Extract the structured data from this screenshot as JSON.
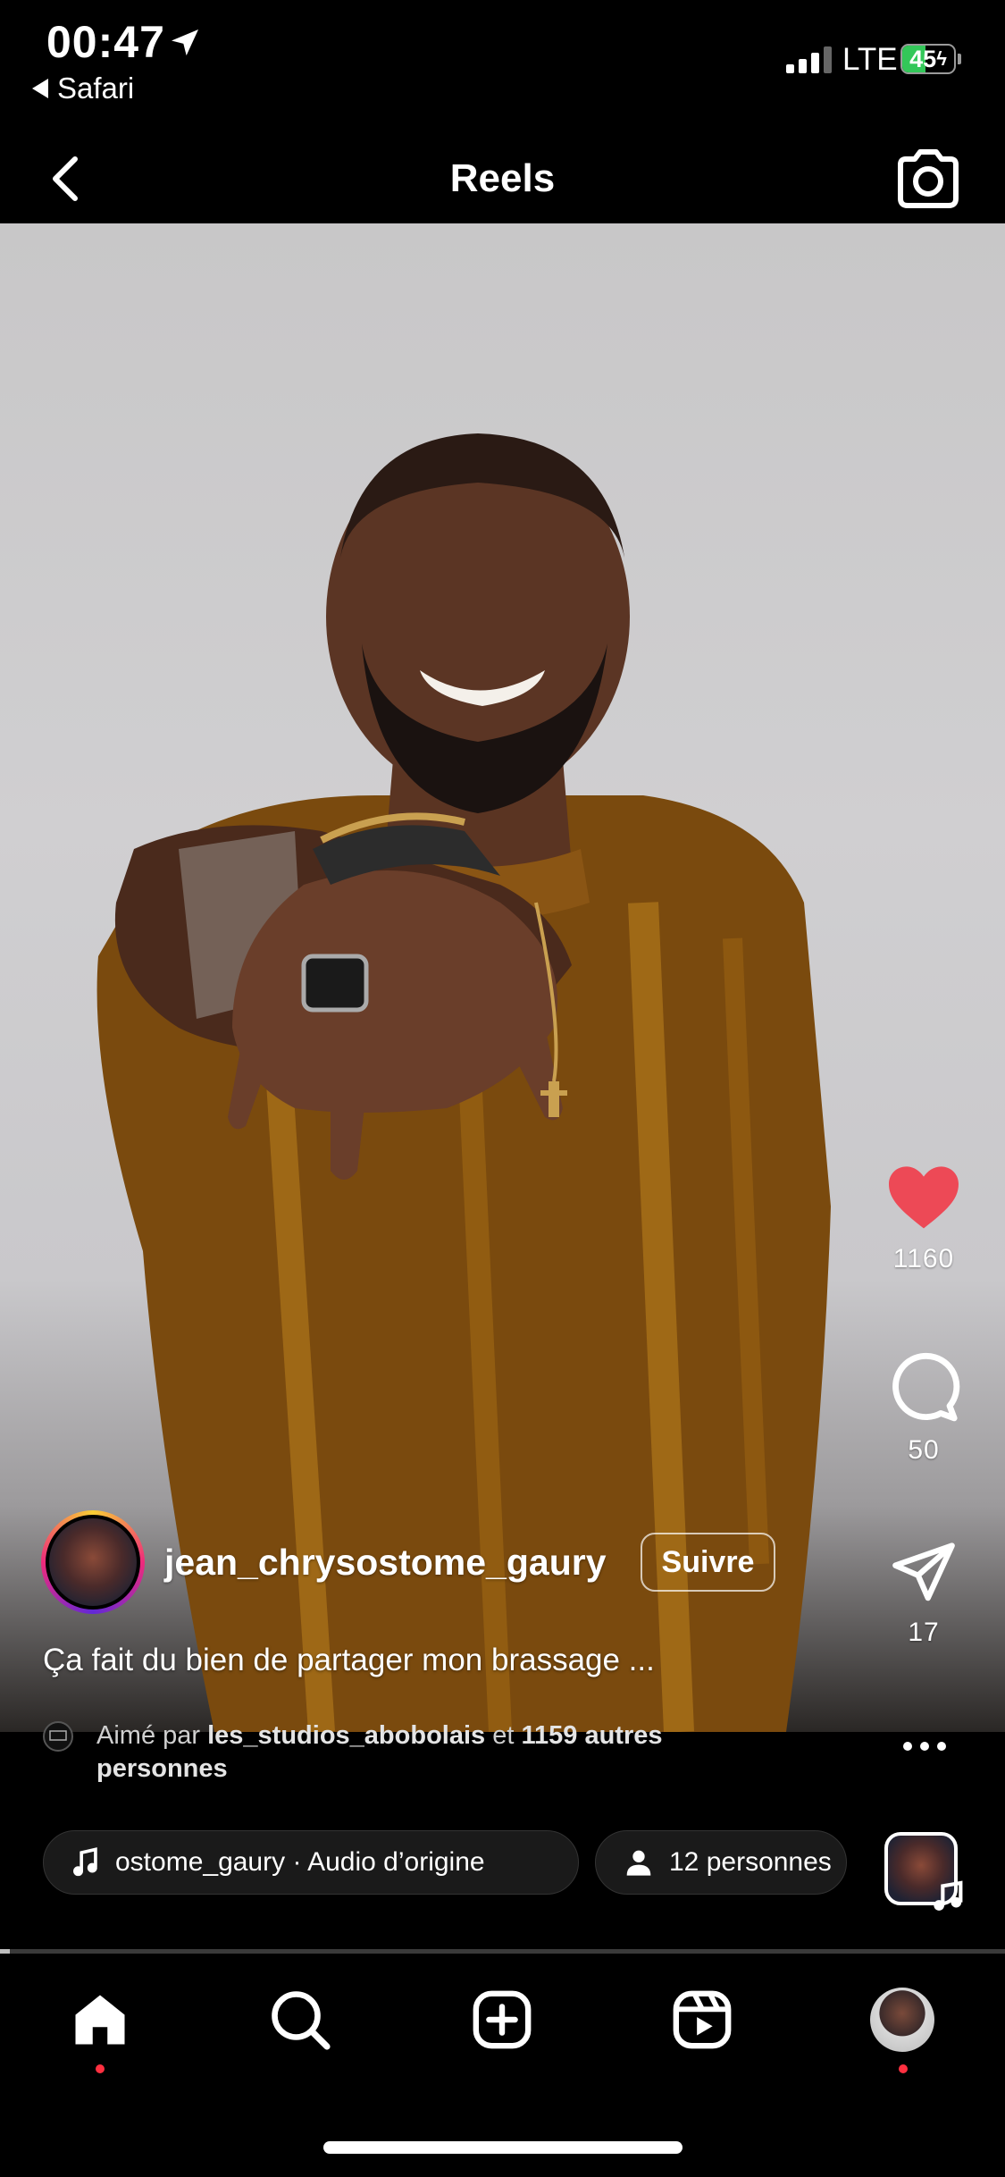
{
  "status_bar": {
    "time": "00:47",
    "back_app": "Safari",
    "network": "LTE",
    "battery_pct": "45",
    "battery_level": 0.45
  },
  "header": {
    "title": "Reels"
  },
  "actions": {
    "likes": "1160",
    "comments": "50",
    "shares": "17"
  },
  "author": {
    "username": "jean_chrysostome_gaury",
    "follow_label": "Suivre"
  },
  "caption": "Ça fait du bien de partager mon brassage ...",
  "liked_by": {
    "prefix": "Aimé par",
    "user": "les_studios_abobolais",
    "connector": "et",
    "others": "1159 autres",
    "suffix": "personnes"
  },
  "audio": {
    "label": "ostome_gaury · Audio d’origine"
  },
  "people": {
    "label": "12 personnes"
  },
  "video": {
    "progress": 0.01
  },
  "colors": {
    "like_red": "#ed4956",
    "notification_red": "#ff3040",
    "battery_green": "#33c759"
  },
  "nav": {
    "items": [
      "home-icon",
      "search-icon",
      "create-icon",
      "reels-icon",
      "profile-avatar"
    ]
  }
}
